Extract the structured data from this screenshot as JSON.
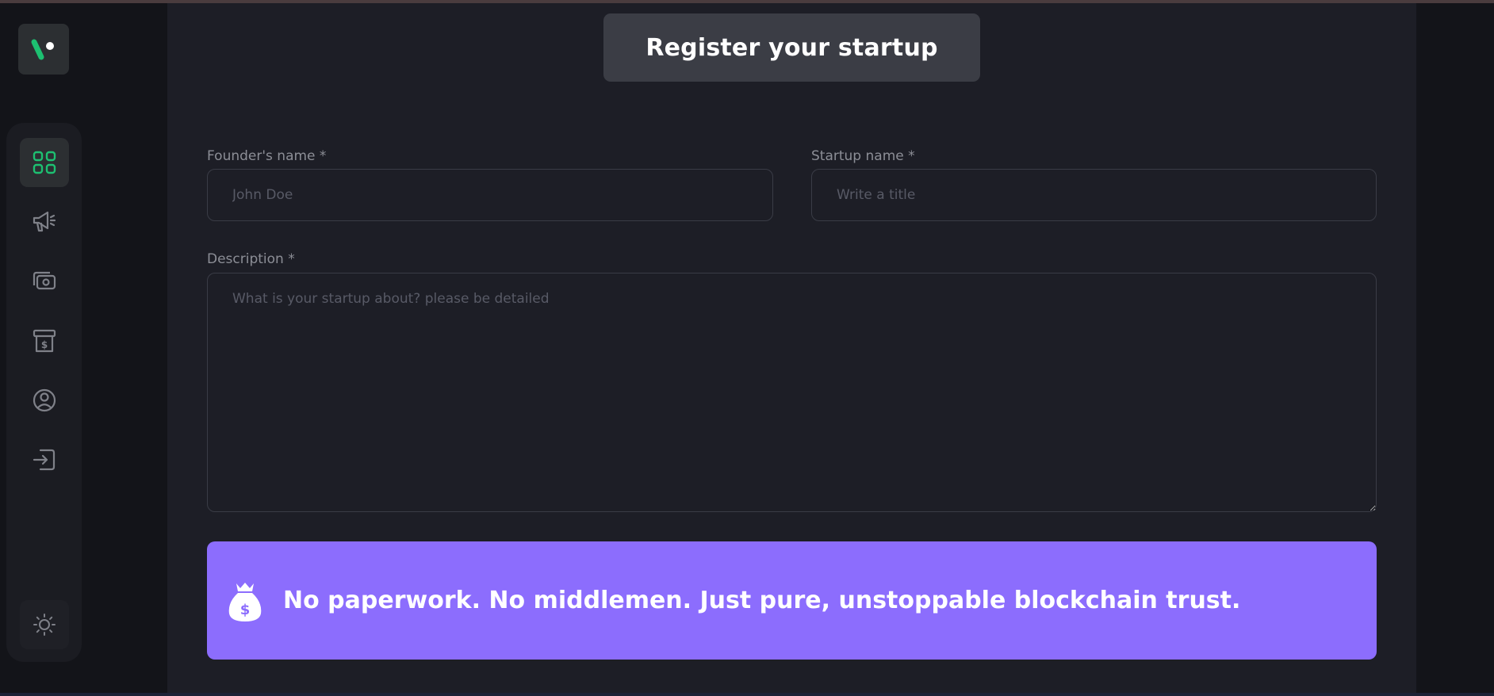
{
  "sidebar": {
    "logo_icon": "v-logo-icon",
    "accent_color": "#1dc071",
    "items": [
      {
        "icon": "dashboard-icon",
        "active": true
      },
      {
        "icon": "megaphone-icon",
        "active": false
      },
      {
        "icon": "payment-icon",
        "active": false
      },
      {
        "icon": "withdraw-icon",
        "active": false
      },
      {
        "icon": "profile-icon",
        "active": false
      },
      {
        "icon": "logout-icon",
        "active": false
      }
    ],
    "theme_icon": "sun-icon"
  },
  "form": {
    "title": "Register your startup",
    "founder": {
      "label": "Founder's name *",
      "placeholder": "John Doe",
      "value": ""
    },
    "startup": {
      "label": "Startup name *",
      "placeholder": "Write a title",
      "value": ""
    },
    "description": {
      "label": "Description *",
      "placeholder": "What is your startup about? please be detailed",
      "value": ""
    }
  },
  "banner": {
    "icon": "money-bag-icon",
    "text": "No paperwork. No middlemen. Just pure, unstoppable blockchain trust.",
    "color": "#8c6dfd"
  }
}
